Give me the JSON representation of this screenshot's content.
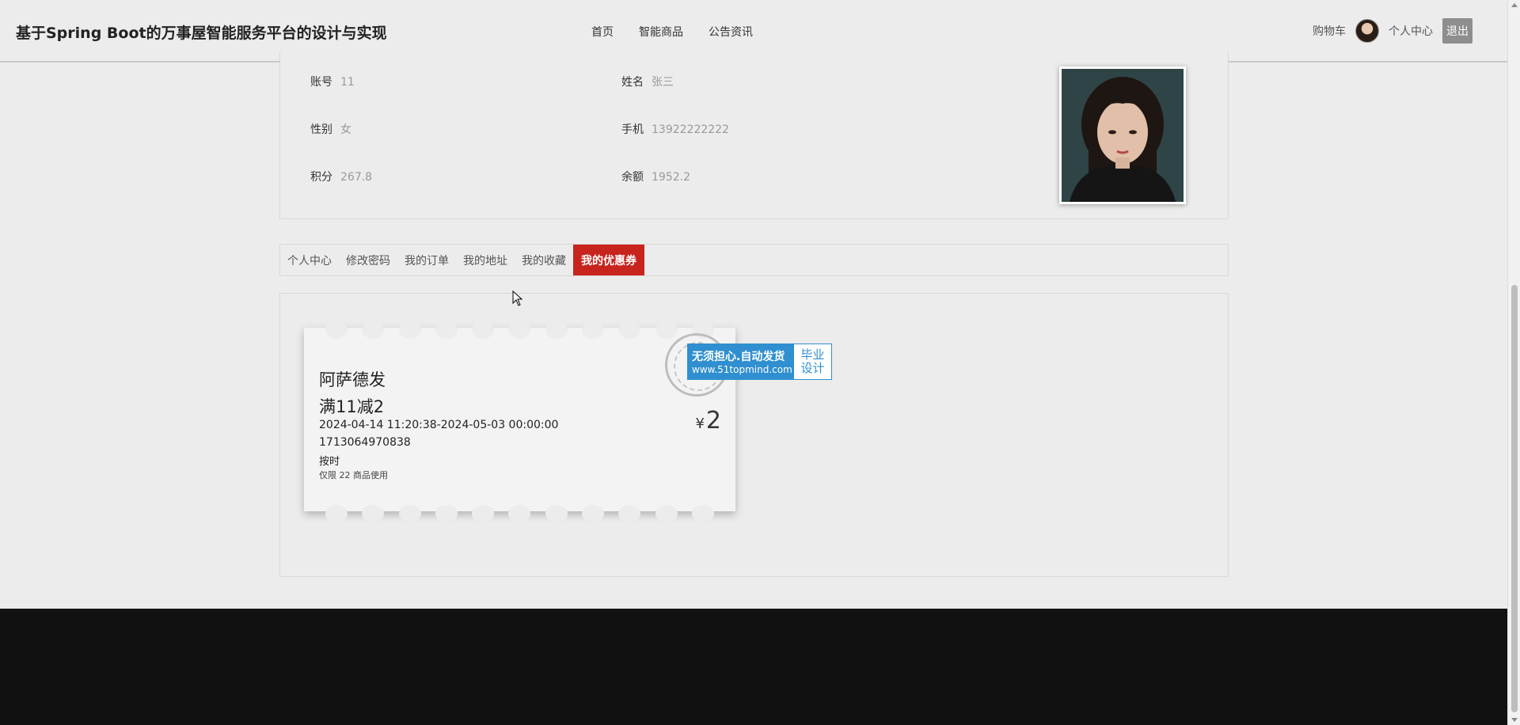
{
  "header": {
    "title": "基于Spring Boot的万事屋智能服务平台的设计与实现",
    "nav": [
      "首页",
      "智能商品",
      "公告资讯"
    ],
    "cart_label": "购物车",
    "profile_label": "个人中心",
    "logout_label": "退出"
  },
  "profile": {
    "account_label": "账号",
    "account_value": "11",
    "name_label": "姓名",
    "name_value": "张三",
    "gender_label": "性别",
    "gender_value": "女",
    "phone_label": "手机",
    "phone_value": "13922222222",
    "points_label": "积分",
    "points_value": "267.8",
    "balance_label": "余额",
    "balance_value": "1952.2"
  },
  "tabs": [
    {
      "label": "个人中心",
      "active": false
    },
    {
      "label": "修改密码",
      "active": false
    },
    {
      "label": "我的订单",
      "active": false
    },
    {
      "label": "我的地址",
      "active": false
    },
    {
      "label": "我的收藏",
      "active": false
    },
    {
      "label": "我的优惠券",
      "active": true
    }
  ],
  "coupon": {
    "name": "阿萨德发",
    "rule": "满11减2",
    "validity": "2024-04-14 11:20:38-2024-05-03 00:00:00",
    "code": "1713064970838",
    "type": "按时",
    "limit": "仅限 22 商品使用",
    "currency": "¥",
    "amount": "2"
  },
  "watermark": {
    "line1": "无须担心.自动发货",
    "line2": "www.51topmind.com",
    "right1": "毕业",
    "right2": "设计"
  },
  "colors": {
    "active_tab": "#c7241e",
    "watermark_blue": "#2f8fd0",
    "footer": "#111111"
  }
}
